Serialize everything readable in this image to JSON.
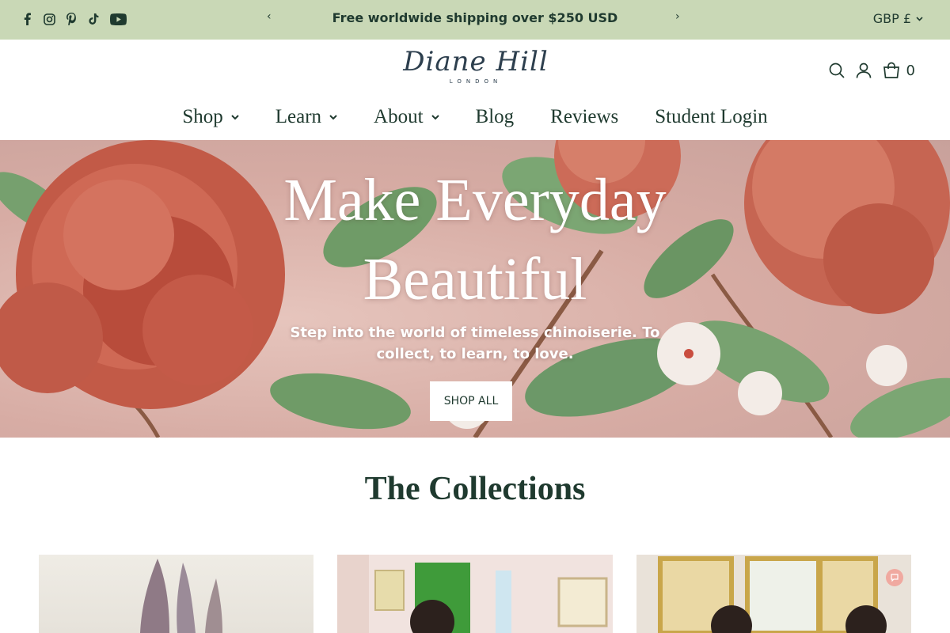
{
  "announcement": {
    "text": "Free worldwide shipping over $250 USD",
    "prev_label": "‹",
    "next_label": "›",
    "currency": "GBP £"
  },
  "social": [
    {
      "icon": "facebook-icon"
    },
    {
      "icon": "instagram-icon"
    },
    {
      "icon": "pinterest-icon"
    },
    {
      "icon": "tiktok-icon"
    },
    {
      "icon": "youtube-icon"
    }
  ],
  "header": {
    "logo_script": "Diane Hill",
    "logo_sub": "LONDON",
    "cart_count": "0"
  },
  "nav": {
    "items": [
      {
        "label": "Shop",
        "dropdown": true
      },
      {
        "label": "Learn",
        "dropdown": true
      },
      {
        "label": "About",
        "dropdown": true
      },
      {
        "label": "Blog",
        "dropdown": false
      },
      {
        "label": "Reviews",
        "dropdown": false
      },
      {
        "label": "Student Login",
        "dropdown": false
      }
    ]
  },
  "hero": {
    "title_line1": "Make Everyday",
    "title_line2": "Beautiful",
    "subtitle": "Step into the world of timeless chinoiserie. To collect, to learn, to love.",
    "button_label": "SHOP ALL"
  },
  "collections": {
    "title": "The Collections"
  },
  "colors": {
    "announcement_bg": "#c9d8b6",
    "brand_green": "#1f3a2f",
    "hero_pink": "#d7aca4"
  }
}
